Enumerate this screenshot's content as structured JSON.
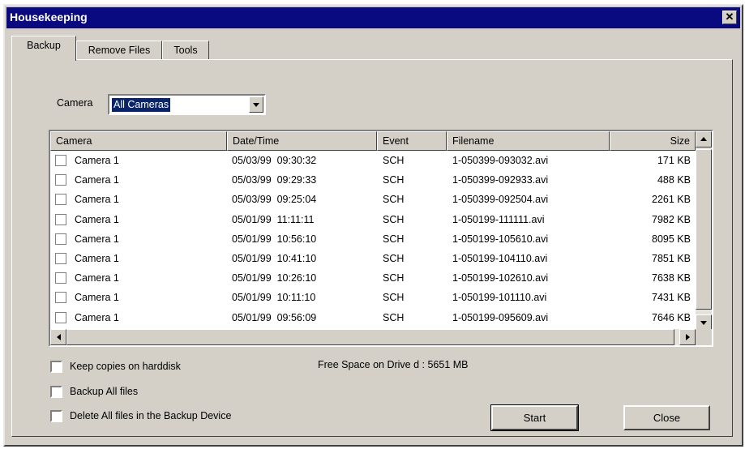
{
  "window": {
    "title": "Housekeeping",
    "close_label": "✕"
  },
  "tabs": [
    {
      "label": "Backup",
      "active": true
    },
    {
      "label": "Remove Files",
      "active": false
    },
    {
      "label": "Tools",
      "active": false
    }
  ],
  "camera_filter": {
    "label": "Camera",
    "value": "All Cameras"
  },
  "table": {
    "columns": [
      "Camera",
      "Date/Time",
      "Event",
      "Filename",
      "Size"
    ],
    "rows": [
      {
        "checked": false,
        "camera": "Camera 1",
        "datetime": "05/03/99  09:30:32",
        "event": "SCH",
        "filename": "1-050399-093032.avi",
        "size": "171 KB"
      },
      {
        "checked": false,
        "camera": "Camera 1",
        "datetime": "05/03/99  09:29:33",
        "event": "SCH",
        "filename": "1-050399-092933.avi",
        "size": "488 KB"
      },
      {
        "checked": false,
        "camera": "Camera 1",
        "datetime": "05/03/99  09:25:04",
        "event": "SCH",
        "filename": "1-050399-092504.avi",
        "size": "2261 KB"
      },
      {
        "checked": false,
        "camera": "Camera 1",
        "datetime": "05/01/99  11:11:11",
        "event": "SCH",
        "filename": "1-050199-111111.avi",
        "size": "7982 KB"
      },
      {
        "checked": false,
        "camera": "Camera 1",
        "datetime": "05/01/99  10:56:10",
        "event": "SCH",
        "filename": "1-050199-105610.avi",
        "size": "8095 KB"
      },
      {
        "checked": false,
        "camera": "Camera 1",
        "datetime": "05/01/99  10:41:10",
        "event": "SCH",
        "filename": "1-050199-104110.avi",
        "size": "7851 KB"
      },
      {
        "checked": false,
        "camera": "Camera 1",
        "datetime": "05/01/99  10:26:10",
        "event": "SCH",
        "filename": "1-050199-102610.avi",
        "size": "7638 KB"
      },
      {
        "checked": false,
        "camera": "Camera 1",
        "datetime": "05/01/99  10:11:10",
        "event": "SCH",
        "filename": "1-050199-101110.avi",
        "size": "7431 KB"
      },
      {
        "checked": false,
        "camera": "Camera 1",
        "datetime": "05/01/99  09:56:09",
        "event": "SCH",
        "filename": "1-050199-095609.avi",
        "size": "7646 KB"
      }
    ]
  },
  "options": [
    {
      "label": "Keep copies on harddisk",
      "checked": false
    },
    {
      "label": "Backup All files",
      "checked": false
    },
    {
      "label": "Delete All files in the Backup Device",
      "checked": false
    }
  ],
  "free_space": "Free Space on Drive d : 5651 MB",
  "buttons": {
    "start": "Start",
    "close": "Close"
  },
  "colors": {
    "title_bar": "#0a0a80",
    "face": "#d4d0c8",
    "selection": "#0a246a"
  }
}
